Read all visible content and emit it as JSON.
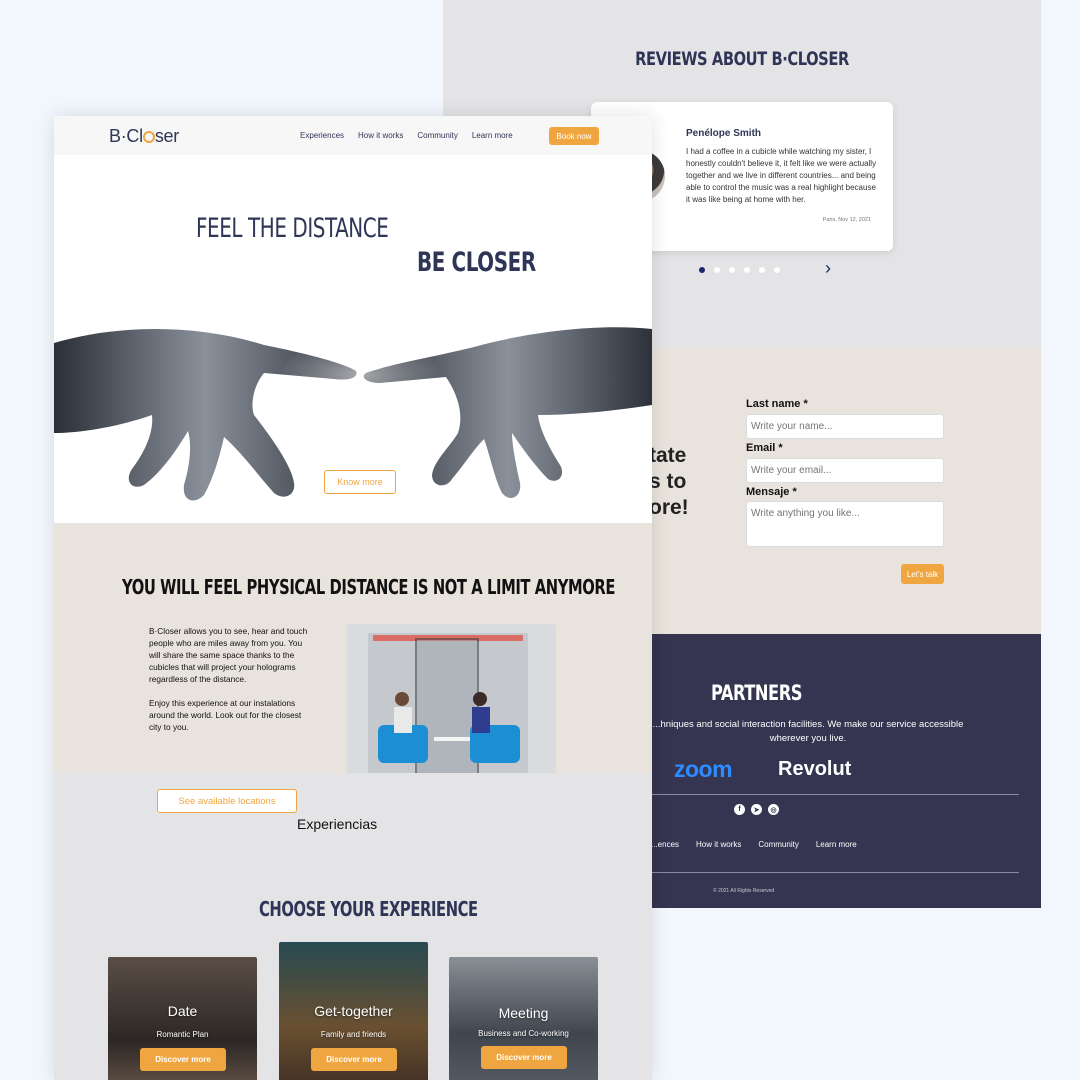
{
  "reviews": {
    "title": "REVIEWS ABOUT B·CLOSER",
    "name": "Penélope Smith",
    "text": "I had a coffee in a cubicle while watching my sister, I honestly couldn't believe it, it felt like we were actually together and we live in different countries... and being able to control the music was a real highlight because it was like being at home with her.",
    "date": "Paris, Nov 12, 2021",
    "prev_icon": "‹",
    "next_icon": "›",
    "dots_count": 6,
    "active_dot": 0
  },
  "contact": {
    "partial_heading_lines": [
      "tate",
      "s to",
      "ore!"
    ],
    "last_name_label": "Last name *",
    "last_name_placeholder": "Write your name...",
    "email_label": "Email *",
    "email_placeholder": "Write your email...",
    "message_label": "Mensaje *",
    "message_placeholder": "Write anything you like...",
    "submit_label": "Let's talk"
  },
  "partners": {
    "title": "PARTNERS",
    "description": "...hniques and social interaction facilities. We make our service accessible wherever you live.",
    "logo1": "zoom",
    "logo2": "Revolut",
    "social_icons": [
      "facebook-icon",
      "telegram-icon",
      "instagram-icon"
    ],
    "footer_nav": [
      "...ences",
      "How it works",
      "Community",
      "Learn more"
    ],
    "copyright": "© 2021 All Rights Reserved"
  },
  "nav": {
    "logo": "B·Closer",
    "logo_before": "B·Cl",
    "logo_after": "ser",
    "links": [
      "Experiences",
      "How it works",
      "Community",
      "Learn more"
    ],
    "cta": "Book now"
  },
  "hero": {
    "line1": "FEEL THE DISTANCE",
    "line2": "BE CLOSER",
    "cta": "Know more"
  },
  "about": {
    "title": "YOU WILL FEEL PHYSICAL DISTANCE IS NOT A LIMIT ANYMORE",
    "paragraph1": "B·Closer allows you to see, hear and touch people who are miles away from you. You will share the same space thanks to the cubicles that will project your holograms regardless of the distance.",
    "paragraph2": "Enjoy this experience at our instalations around the world. Look out for the closest city to you.",
    "cta": "See available locations",
    "experiencias": "Experiencias"
  },
  "experiences": {
    "title": "CHOOSE YOUR EXPERIENCE",
    "cards": [
      {
        "title": "Date",
        "subtitle": "Romantic Plan",
        "cta": "Discover more"
      },
      {
        "title": "Get-together",
        "subtitle": "Family and friends",
        "cta": "Discover more"
      },
      {
        "title": "Meeting",
        "subtitle": "Business and Co-working",
        "cta": "Discover more"
      }
    ]
  },
  "colors": {
    "accent": "#f0a640",
    "navy": "#2f3556",
    "footer_bg": "#353451",
    "beige": "#e8e3dc",
    "grey": "#e4e4e6"
  }
}
